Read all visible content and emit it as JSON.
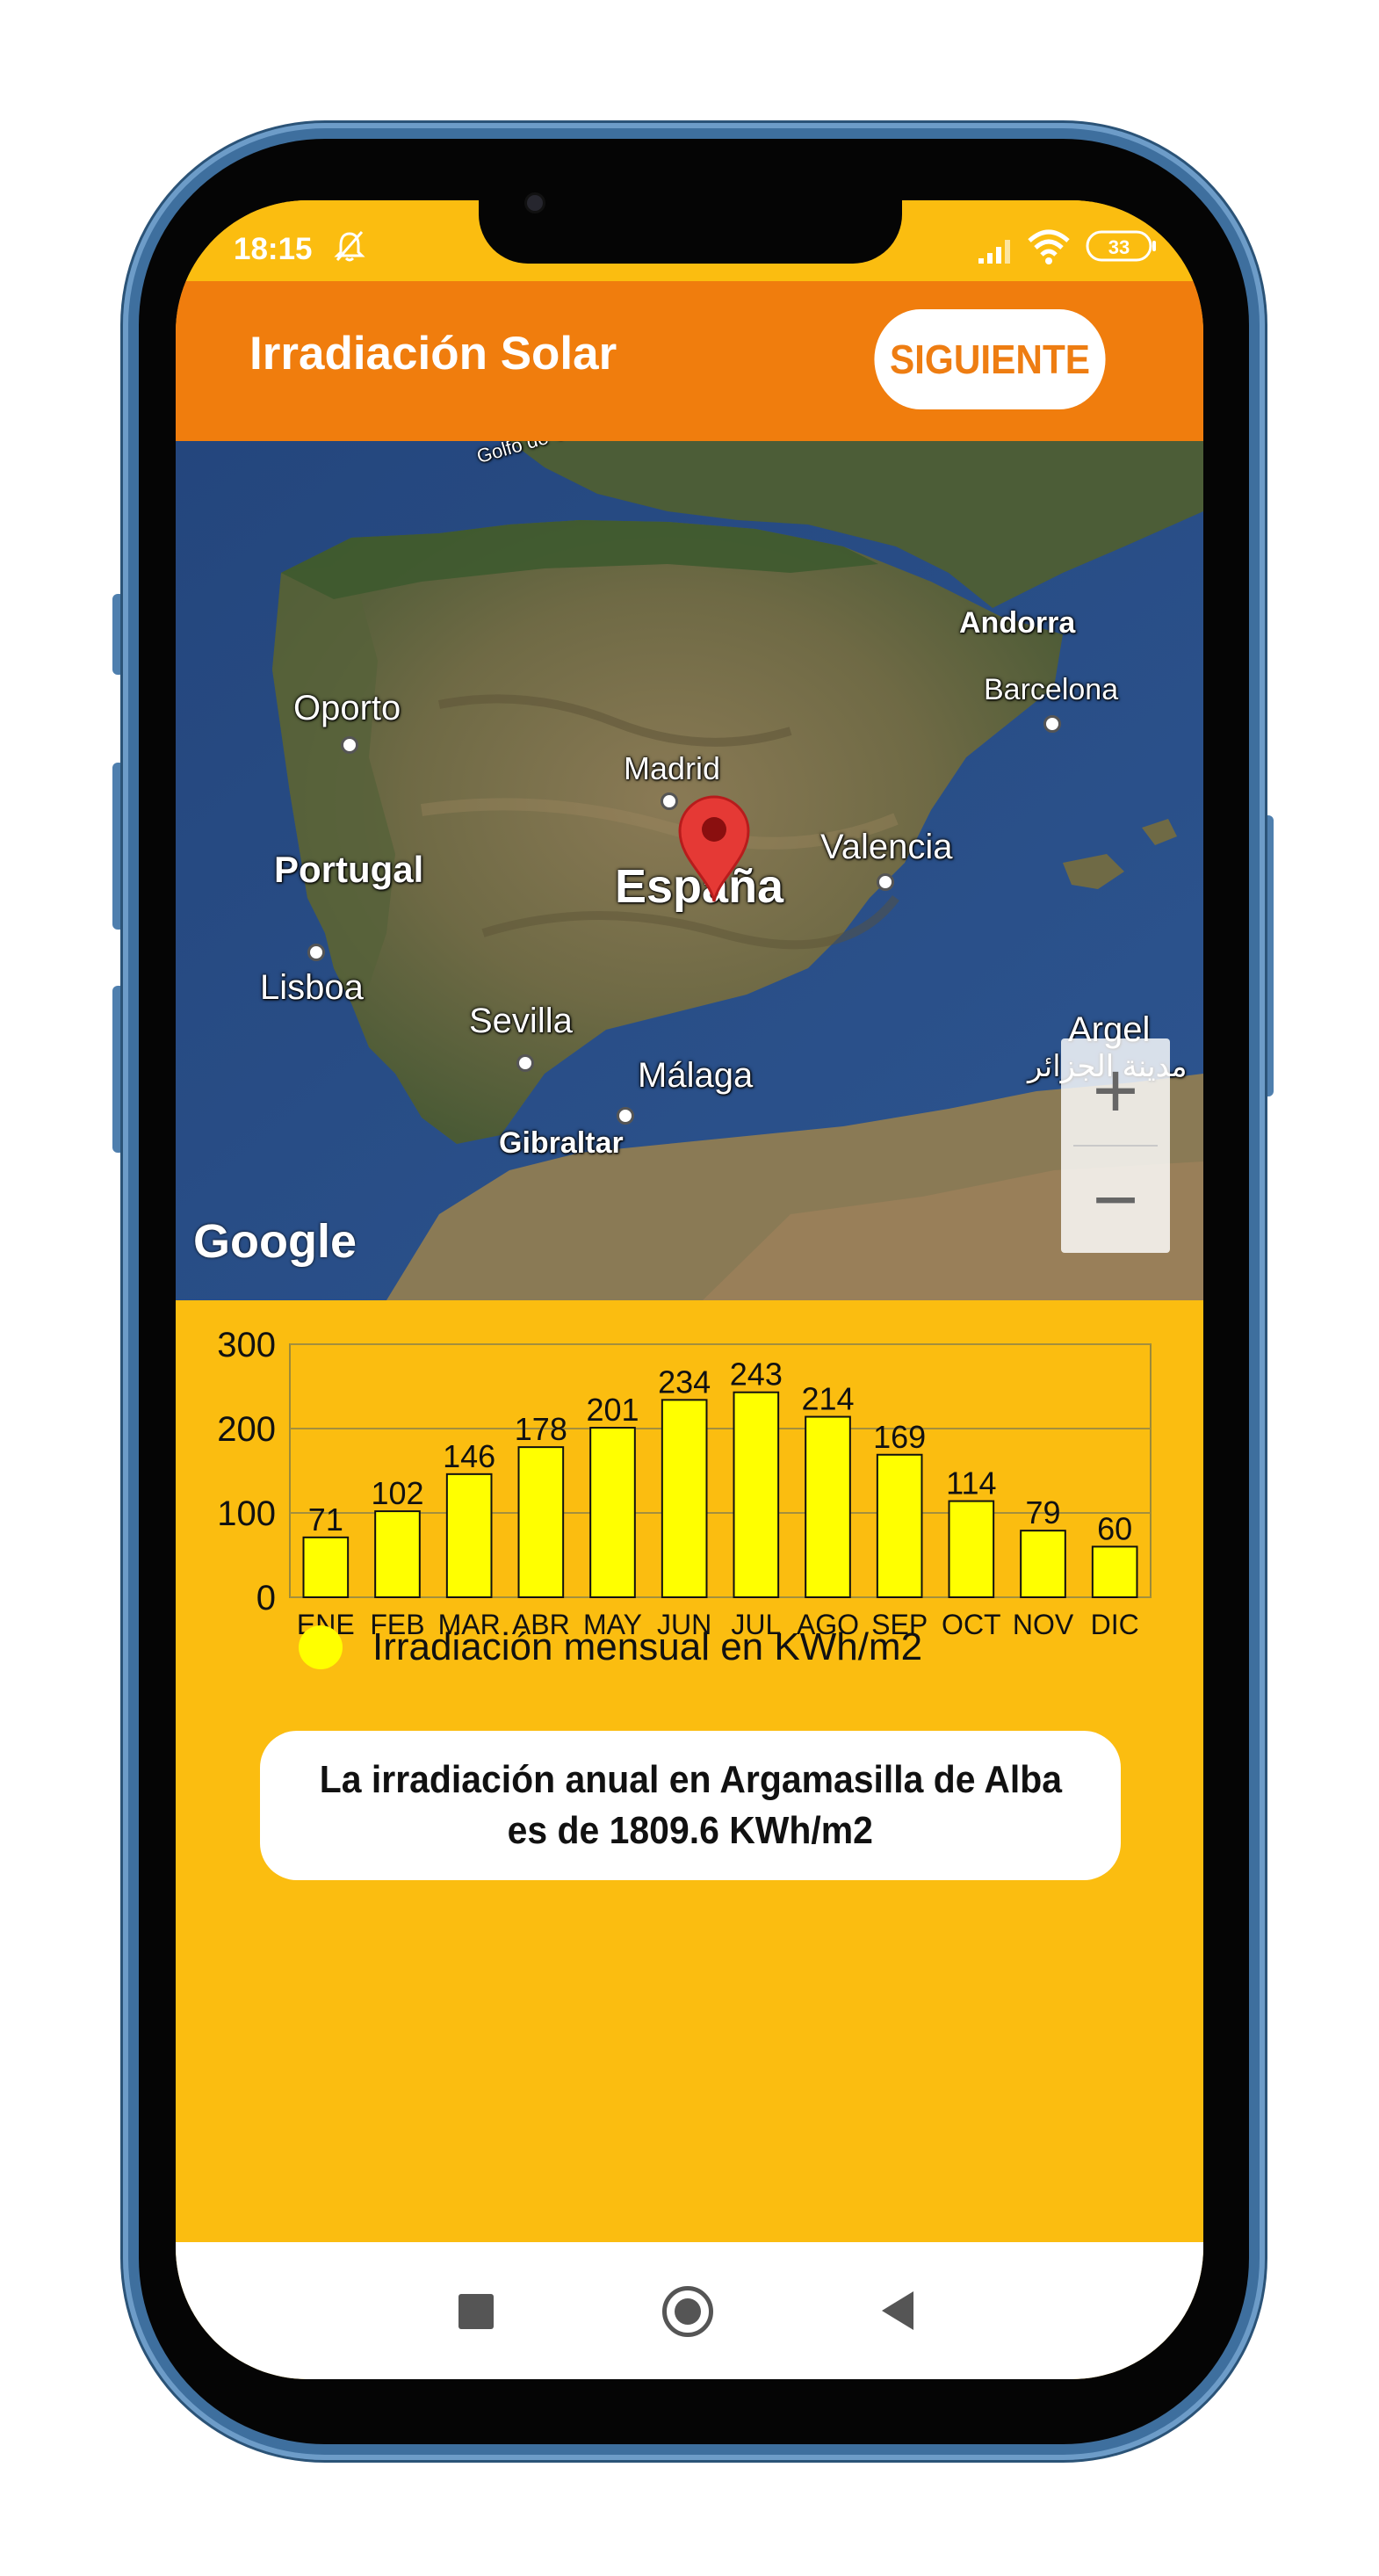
{
  "status_bar": {
    "time": "18:15",
    "battery": "33",
    "icons": [
      "bell-off-icon",
      "signal-icon",
      "wifi-icon",
      "battery-icon"
    ]
  },
  "app_bar": {
    "title": "Irradiación Solar",
    "next_button": "SIGUIENTE",
    "background_color": "#f07d0d"
  },
  "map": {
    "labels": {
      "golfo": "Golfo de Vi",
      "andorra": "Andorra",
      "barcelona": "Barcelona",
      "oporto": "Oporto",
      "madrid": "Madrid",
      "valencia": "Valencia",
      "portugal": "Portugal",
      "espana": "España",
      "lisboa": "Lisboa",
      "sevilla": "Sevilla",
      "malaga": "Málaga",
      "argel": "Argel",
      "argel_ar": "مدينة الجزائر",
      "gibraltar": "Gibraltar"
    },
    "attribution": "Google",
    "zoom_in": "+",
    "zoom_out": "−",
    "marker_icon": "map-pin-icon"
  },
  "chart_data": {
    "type": "bar",
    "categories": [
      "ENE",
      "FEB",
      "MAR",
      "ABR",
      "MAY",
      "JUN",
      "JUL",
      "AGO",
      "SEP",
      "OCT",
      "NOV",
      "DIC"
    ],
    "series": [
      {
        "name": "Irradiación mensual en KWh/m2",
        "values": [
          71,
          102,
          146,
          178,
          201,
          234,
          243,
          214,
          169,
          114,
          79,
          60
        ],
        "color": "#ffff00"
      }
    ],
    "yticks": [
      0,
      100,
      200,
      300
    ],
    "ylim": [
      0,
      300
    ],
    "grid": true,
    "legend": "bottom"
  },
  "result": {
    "line1": "La irradiación anual en Argamasilla de Alba",
    "line2": "es de 1809.6 KWh/m2"
  },
  "colors": {
    "screen_background": "#fbbd10",
    "bar_fill": "#ffff00"
  },
  "nav_bar": {
    "icons": [
      "recents-square-icon",
      "home-circle-icon",
      "back-triangle-icon"
    ]
  }
}
